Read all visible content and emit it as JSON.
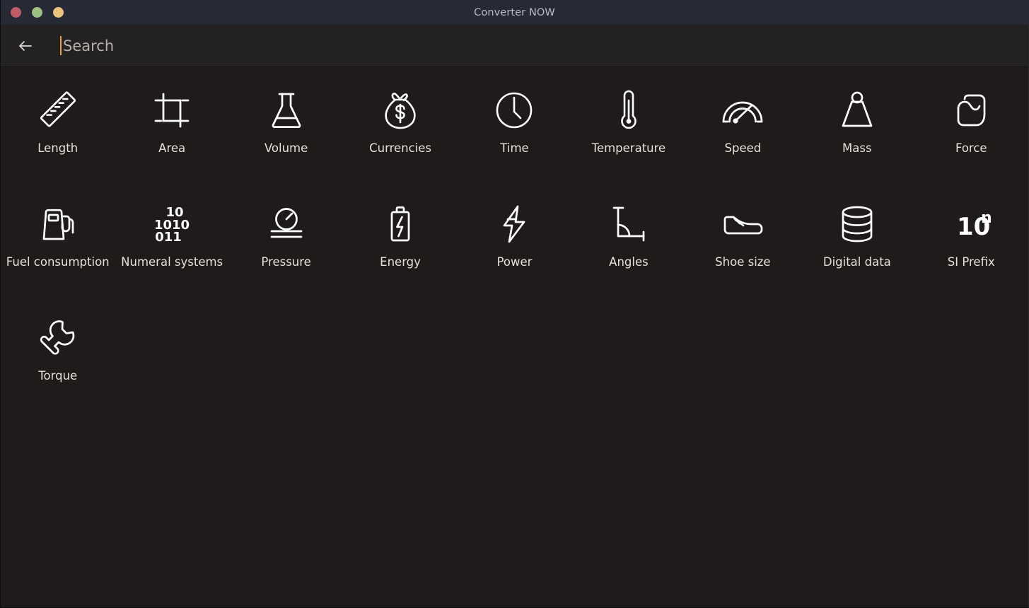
{
  "window": {
    "title": "Converter NOW",
    "traffic_lights": [
      {
        "name": "close",
        "color": "#c15b67"
      },
      {
        "name": "minimize",
        "color": "#9cc185"
      },
      {
        "name": "maximize",
        "color": "#e9c37e"
      }
    ]
  },
  "appbar": {
    "back_icon": "arrow-left-icon",
    "search": {
      "value": "",
      "placeholder": "Search",
      "caret_color": "#e8a33d"
    }
  },
  "colors": {
    "titlebar_bg": "#272935",
    "appbar_bg": "#232121",
    "content_bg": "#1e1b1a",
    "icon": "#ffffff",
    "label": "#e6e1d9",
    "accent": "#e8a33d"
  },
  "grid": {
    "columns": 9,
    "items": [
      {
        "label": "Length",
        "icon": "ruler-icon"
      },
      {
        "label": "Area",
        "icon": "crop-frame-icon"
      },
      {
        "label": "Volume",
        "icon": "flask-icon"
      },
      {
        "label": "Currencies",
        "icon": "money-bag-icon"
      },
      {
        "label": "Time",
        "icon": "clock-icon"
      },
      {
        "label": "Temperature",
        "icon": "thermometer-icon"
      },
      {
        "label": "Speed",
        "icon": "speedometer-icon"
      },
      {
        "label": "Mass",
        "icon": "weight-icon"
      },
      {
        "label": "Force",
        "icon": "bicep-icon"
      },
      {
        "label": "Fuel consumption",
        "icon": "fuel-pump-icon"
      },
      {
        "label": "Numeral systems",
        "icon": "binary-digits-icon",
        "glyph_lines": [
          "10",
          "1010",
          "011"
        ]
      },
      {
        "label": "Pressure",
        "icon": "pressure-gauge-icon"
      },
      {
        "label": "Energy",
        "icon": "battery-bolt-icon"
      },
      {
        "label": "Power",
        "icon": "lightning-bolt-icon"
      },
      {
        "label": "Angles",
        "icon": "angle-icon"
      },
      {
        "label": "Shoe size",
        "icon": "shoe-icon"
      },
      {
        "label": "Digital data",
        "icon": "database-icon"
      },
      {
        "label": "SI Prefix",
        "icon": "ten-power-n-icon",
        "glyph_base": "10",
        "glyph_exp": "n"
      },
      {
        "label": "Torque",
        "icon": "wrench-icon"
      }
    ]
  }
}
